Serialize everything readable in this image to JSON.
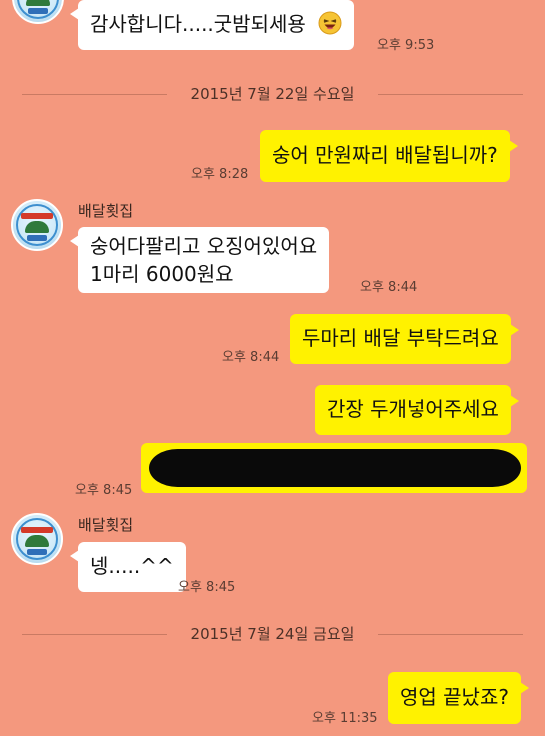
{
  "colors": {
    "background": "#f4987e",
    "incoming_bubble": "#ffffff",
    "outgoing_bubble": "#fff200"
  },
  "messages": {
    "m1": {
      "text": "감사합니다.....굿밤되세용",
      "time": "오후 9:53",
      "emoji": "laughing-face"
    },
    "date1": "2015년 7월 22일 수요일",
    "m2": {
      "text": "숭어 만원짜리 배달됩니까?",
      "time": "오후 8:28"
    },
    "sender1": "배달횟집",
    "m3": {
      "line1": "숭어다팔리고 오징어있어요",
      "line2": "1마리 6000원요",
      "time": "오후 8:44"
    },
    "m4": {
      "text": "두마리 배달 부탁드려요",
      "time": "오후 8:44"
    },
    "m5": {
      "text": "간장 두개넣어주세요"
    },
    "m6": {
      "time": "오후 8:45",
      "content": "redacted"
    },
    "sender2": "배달횟집",
    "m7": {
      "text": "넹.....^^",
      "time": "오후 8:45"
    },
    "date2": "2015년 7월 24일 금요일",
    "m8": {
      "text": "영업 끝났죠?",
      "time": "오후 11:35"
    }
  }
}
